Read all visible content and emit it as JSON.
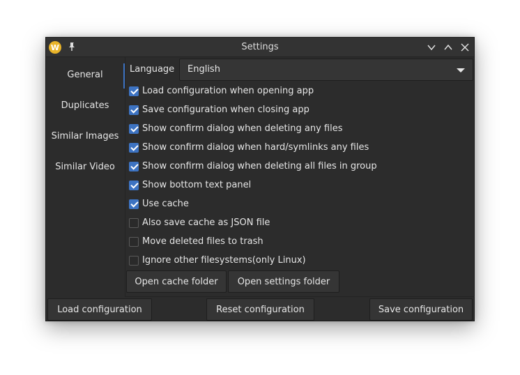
{
  "window": {
    "title": "Settings",
    "app_icon_letter": "W"
  },
  "sidebar": {
    "items": [
      {
        "label": "General"
      },
      {
        "label": "Duplicates"
      },
      {
        "label": "Similar Images"
      },
      {
        "label": "Similar Video"
      }
    ],
    "selected": "General"
  },
  "general": {
    "language_label": "Language",
    "language_value": "English",
    "checkboxes": [
      {
        "label": "Load configuration when opening app",
        "checked": true
      },
      {
        "label": "Save configuration when closing app",
        "checked": true
      },
      {
        "label": "Show confirm dialog when deleting any files",
        "checked": true
      },
      {
        "label": "Show confirm dialog when hard/symlinks any files",
        "checked": true
      },
      {
        "label": "Show confirm dialog when deleting all files in group",
        "checked": true
      },
      {
        "label": "Show bottom text panel",
        "checked": true
      },
      {
        "label": "Use cache",
        "checked": true
      },
      {
        "label": "Also save cache as JSON file",
        "checked": false
      },
      {
        "label": "Move deleted files to trash",
        "checked": false
      },
      {
        "label": "Ignore other filesystems(only Linux)",
        "checked": false
      }
    ],
    "open_cache_folder": "Open cache folder",
    "open_settings_folder": "Open settings folder"
  },
  "footer": {
    "load": "Load configuration",
    "reset": "Reset configuration",
    "save": "Save configuration"
  },
  "colors": {
    "accent": "#3d73c2",
    "window_bg": "#2c2c2c",
    "app_icon": "#e9b429"
  }
}
